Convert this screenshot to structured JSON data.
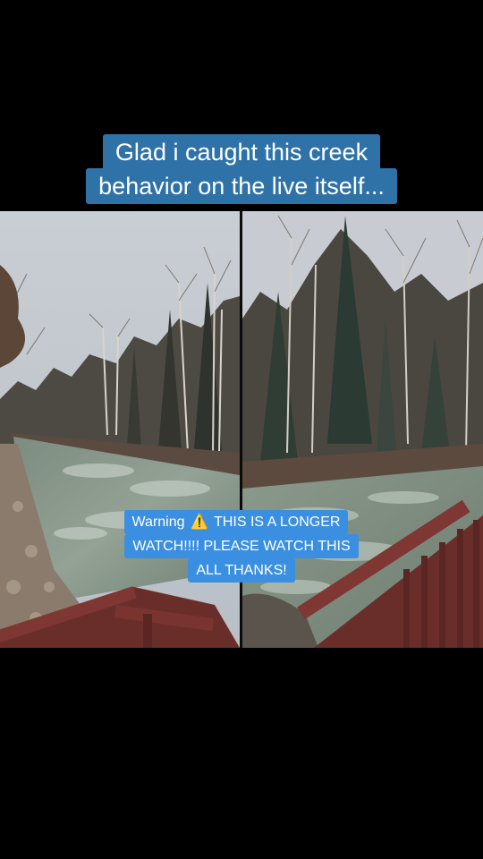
{
  "caption": {
    "title_line_1": "Glad i caught this creek",
    "title_line_2": "behavior on the live itself..."
  },
  "warning": {
    "prefix": "Warning",
    "icon": "warning-sign-icon",
    "icon_glyph": "⚠️",
    "line_1_rest": "THIS IS A LONGER",
    "line_2": "WATCH!!!! PLEASE WATCH THIS",
    "line_3": "ALL THANKS!"
  },
  "colors": {
    "title_bg": "#2f72a7",
    "warning_bg": "#3b8fe0",
    "background": "#000000"
  }
}
